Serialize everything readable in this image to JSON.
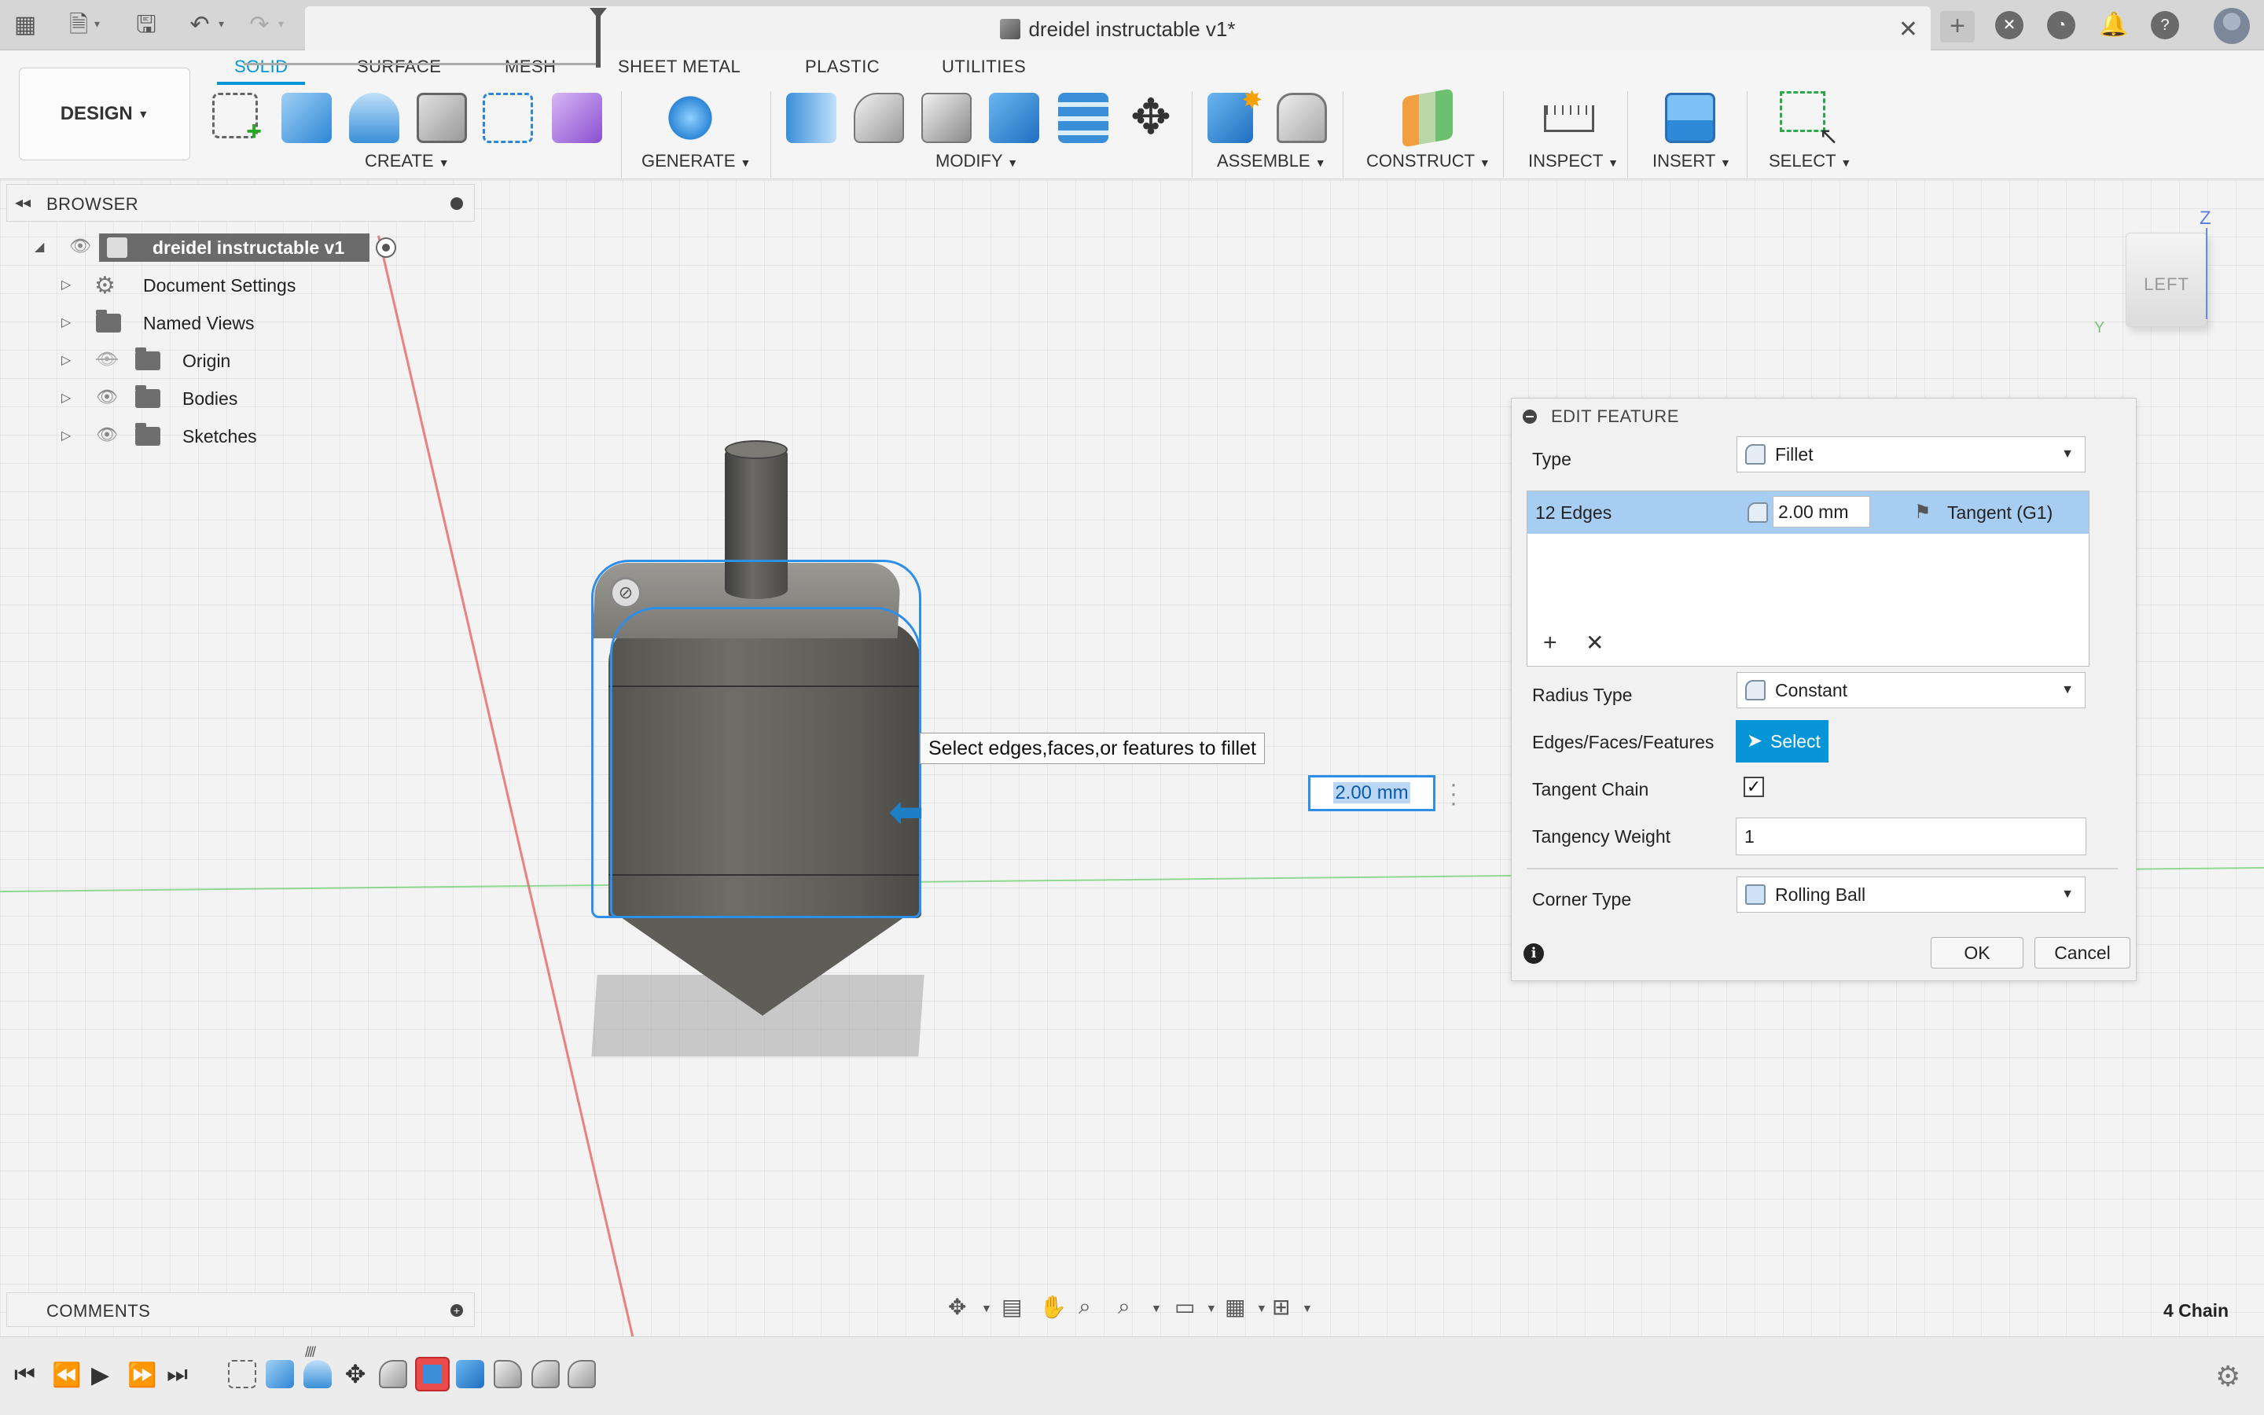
{
  "app": {
    "document_title": "dreidel instructable v1*"
  },
  "ribbon": {
    "workspace": "DESIGN",
    "tabs": [
      "SOLID",
      "SURFACE",
      "MESH",
      "SHEET METAL",
      "PLASTIC",
      "UTILITIES"
    ],
    "active_tab": "SOLID",
    "groups": [
      "CREATE",
      "GENERATE",
      "MODIFY",
      "ASSEMBLE",
      "CONSTRUCT",
      "INSPECT",
      "INSERT",
      "SELECT"
    ]
  },
  "browser": {
    "title": "BROWSER",
    "root": "dreidel instructable v1",
    "items": [
      {
        "label": "Document Settings",
        "icon": "gear-icon",
        "visible": null
      },
      {
        "label": "Named Views",
        "icon": "folder-icon",
        "visible": null
      },
      {
        "label": "Origin",
        "icon": "folder-icon",
        "visible": false
      },
      {
        "label": "Bodies",
        "icon": "folder-icon",
        "visible": true
      },
      {
        "label": "Sketches",
        "icon": "folder-icon",
        "visible": true
      }
    ]
  },
  "viewport": {
    "tooltip": "Select edges,faces,or features to fillet",
    "dimension_value": "2.00 mm",
    "viewcube_face": "LEFT",
    "axis_z": "Z",
    "axis_y": "Y",
    "status": "4 Chain"
  },
  "dialog": {
    "title": "EDIT FEATURE",
    "type_label": "Type",
    "type_value": "Fillet",
    "edges_row": {
      "count": "12 Edges",
      "radius": "2.00 mm",
      "continuity": "Tangent (G1)"
    },
    "radius_type_label": "Radius Type",
    "radius_type_value": "Constant",
    "selection_label": "Edges/Faces/Features",
    "select_button": "Select",
    "tangent_chain_label": "Tangent Chain",
    "tangent_chain_checked": "✓",
    "tangency_weight_label": "Tangency Weight",
    "tangency_weight_value": "1",
    "corner_type_label": "Corner Type",
    "corner_type_value": "Rolling Ball",
    "ok": "OK",
    "cancel": "Cancel"
  },
  "comments": {
    "title": "COMMENTS"
  },
  "colors": {
    "accent": "#0696d7",
    "selection": "#2f8fe8",
    "edge_row_highlight": "#a8cdf2"
  }
}
